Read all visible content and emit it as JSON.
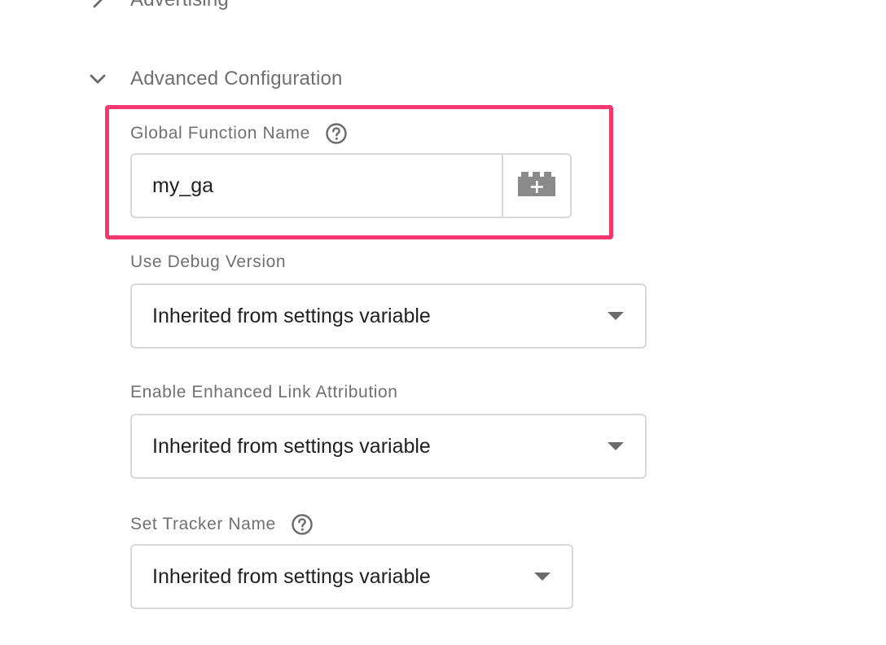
{
  "sections": {
    "advertising": {
      "title": "Advertising",
      "expanded": false
    },
    "advanced": {
      "title": "Advanced Configuration",
      "expanded": true
    }
  },
  "fields": {
    "global_function_name": {
      "label": "Global Function Name",
      "value": "my_ga",
      "help_icon": "help-circle-icon",
      "variable_button_icon": "add-variable-brick-icon"
    },
    "use_debug_version": {
      "label": "Use Debug Version",
      "selected": "Inherited from settings variable"
    },
    "enhanced_link_attribution": {
      "label": "Enable Enhanced Link Attribution",
      "selected": "Inherited from settings variable"
    },
    "set_tracker_name": {
      "label": "Set Tracker Name",
      "selected": "Inherited from settings variable",
      "help_icon": "help-circle-icon"
    }
  },
  "colors": {
    "highlight": "#f4376d",
    "label": "#707070",
    "border": "#d8d8d8",
    "text": "#212121",
    "icon": "#6b6b6b"
  }
}
